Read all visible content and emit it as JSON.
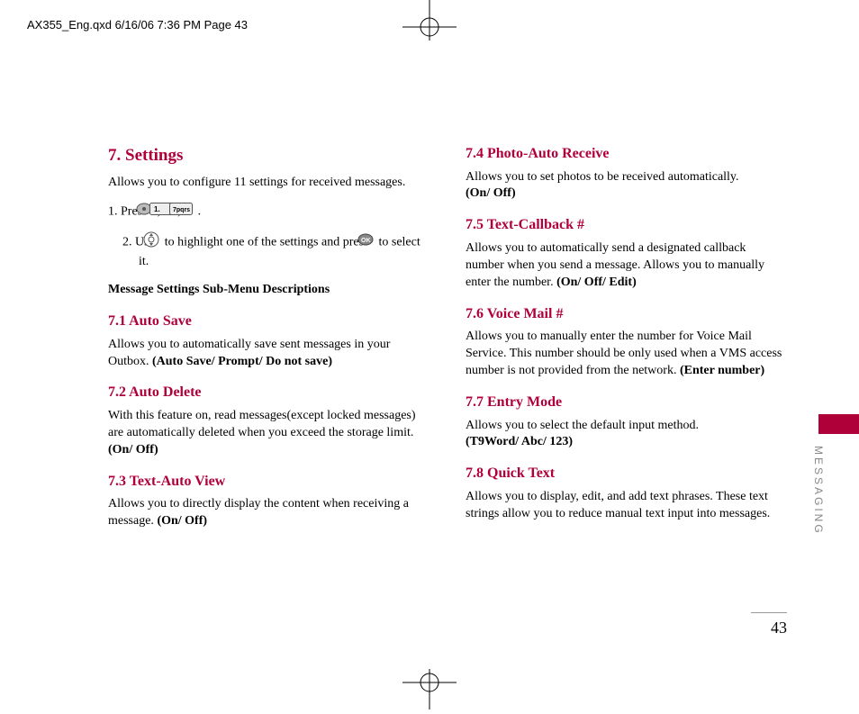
{
  "header": "AX355_Eng.qxd  6/16/06  7:36 PM  Page 43",
  "left": {
    "h1": "7. Settings",
    "intro": "Allows you to configure 11 settings for received messages.",
    "step1_prefix": "1. Press ",
    "step1_commas": " , ",
    "step1_end": " .",
    "step2_prefix": "2. Use ",
    "step2_mid": " to highlight one of the settings and press ",
    "step2_end": " to select it.",
    "submenu_heading": "Message Settings Sub-Menu Descriptions",
    "s71": "7.1 Auto Save",
    "s71_body": "Allows you to automatically save sent messages in your Outbox. ",
    "s71_bold": "(Auto Save/ Prompt/ Do not save)",
    "s72": "7.2 Auto Delete",
    "s72_body": "With this feature on, read messages(except locked messages) are automatically deleted when you exceed the storage limit. ",
    "s72_bold": "(On/ Off)",
    "s73": "7.3 Text-Auto View",
    "s73_body": "Allows you to directly display the content when receiving a message. ",
    "s73_bold": "(On/ Off)"
  },
  "right": {
    "s74": "7.4 Photo-Auto Receive",
    "s74_body": "Allows you to set photos to be received automatically. ",
    "s74_bold": "(On/ Off)",
    "s75": "7.5 Text-Callback #",
    "s75_body": "Allows you to automatically send a designated callback number when you send a message. Allows you to manually enter the number. ",
    "s75_bold": "(On/ Off/ Edit)",
    "s76": "7.6 Voice Mail #",
    "s76_body": "Allows you to manually enter the number for Voice Mail Service. This number should be only used when a VMS access number is not provided from the network. ",
    "s76_bold": "(Enter number)",
    "s77": "7.7 Entry Mode",
    "s77_body": "Allows you to select the default input method. ",
    "s77_bold": "(T9Word/ Abc/ 123)",
    "s78": "7.8 Quick Text",
    "s78_body": "Allows you to display, edit, and add text phrases. These text strings allow you to reduce manual text input into messages."
  },
  "side_label": "MESSAGING",
  "page_number": "43"
}
